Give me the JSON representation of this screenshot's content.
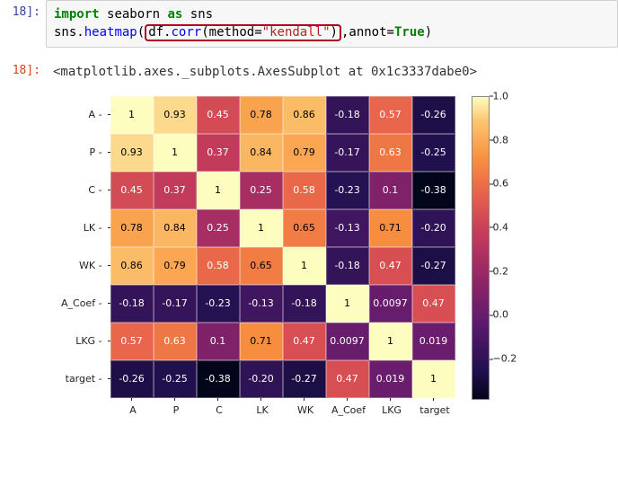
{
  "input_prompt": "18]:",
  "output_prompt": "18]:",
  "code": {
    "kw_import": "import",
    "mod": "seaborn",
    "kw_as": "as",
    "alias": "sns",
    "obj": "sns",
    "dot1": ".",
    "fn": "heatmap",
    "paren_open": "(",
    "df": "df",
    "dot2": ".",
    "corr": "corr",
    "sub_open": "(",
    "method_arg": "method",
    "eq": "=",
    "method_val": "\"kendall\"",
    "sub_close": ")",
    "comma": ",",
    "annot_arg": "annot",
    "annot_eq": "=",
    "annot_val": "True",
    "paren_close": ")"
  },
  "output_text": "<matplotlib.axes._subplots.AxesSubplot at 0x1c3337dabe0>",
  "chart_data": {
    "type": "heatmap",
    "labels": [
      "A",
      "P",
      "C",
      "LK",
      "WK",
      "A_Coef",
      "LKG",
      "target"
    ],
    "matrix": [
      [
        1,
        0.93,
        0.45,
        0.78,
        0.86,
        -0.18,
        0.57,
        -0.26
      ],
      [
        0.93,
        1,
        0.37,
        0.84,
        0.79,
        -0.17,
        0.63,
        -0.25
      ],
      [
        0.45,
        0.37,
        1,
        0.25,
        0.58,
        -0.23,
        0.1,
        -0.38
      ],
      [
        0.78,
        0.84,
        0.25,
        1,
        0.65,
        -0.13,
        0.71,
        -0.2
      ],
      [
        0.86,
        0.79,
        0.58,
        0.65,
        1,
        -0.18,
        0.47,
        -0.27
      ],
      [
        -0.18,
        -0.17,
        -0.23,
        -0.13,
        -0.18,
        1,
        0.0097,
        0.47
      ],
      [
        0.57,
        0.63,
        0.1,
        0.71,
        0.47,
        0.0097,
        1,
        0.019
      ],
      [
        -0.26,
        -0.25,
        -0.38,
        -0.2,
        -0.27,
        0.47,
        0.019,
        1
      ]
    ],
    "vmin": -0.38,
    "vmax": 1.0,
    "colorbar_ticks": [
      {
        "label": "1.0",
        "pos": 0
      },
      {
        "label": "0.8",
        "pos": 0.145
      },
      {
        "label": "0.6",
        "pos": 0.29
      },
      {
        "label": "0.4",
        "pos": 0.435
      },
      {
        "label": "0.2",
        "pos": 0.58
      },
      {
        "label": "0.0",
        "pos": 0.725
      },
      {
        "label": "−0.2",
        "pos": 0.87
      }
    ]
  }
}
